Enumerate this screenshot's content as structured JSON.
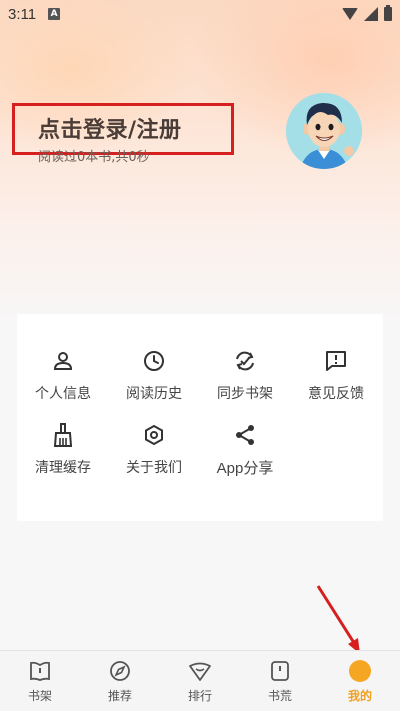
{
  "status_bar": {
    "time": "3:11",
    "notification_icon": "A"
  },
  "header": {
    "login_prompt": "点击登录/注册",
    "read_stats": "阅读过0本书,共0秒",
    "avatar_icon": "cartoon-boy-avatar"
  },
  "menu": {
    "items": [
      {
        "label": "个人信息",
        "icon": "person-icon"
      },
      {
        "label": "阅读历史",
        "icon": "clock-icon"
      },
      {
        "label": "同步书架",
        "icon": "sync-icon"
      },
      {
        "label": "意见反馈",
        "icon": "feedback-icon"
      },
      {
        "label": "清理缓存",
        "icon": "broom-icon"
      },
      {
        "label": "关于我们",
        "icon": "hexagon-nut-icon"
      },
      {
        "label": "App分享",
        "icon": "share-icon"
      }
    ]
  },
  "bottom_nav": {
    "items": [
      {
        "label": "书架",
        "icon": "book-icon"
      },
      {
        "label": "推荐",
        "icon": "compass-icon"
      },
      {
        "label": "排行",
        "icon": "ranking-icon"
      },
      {
        "label": "书荒",
        "icon": "card-icon"
      },
      {
        "label": "我的",
        "icon": "profile-dot-icon",
        "active": true
      }
    ]
  },
  "colors": {
    "accent": "#f5a623",
    "highlight_box": "#d62020",
    "annotation_arrow": "#d62020"
  }
}
